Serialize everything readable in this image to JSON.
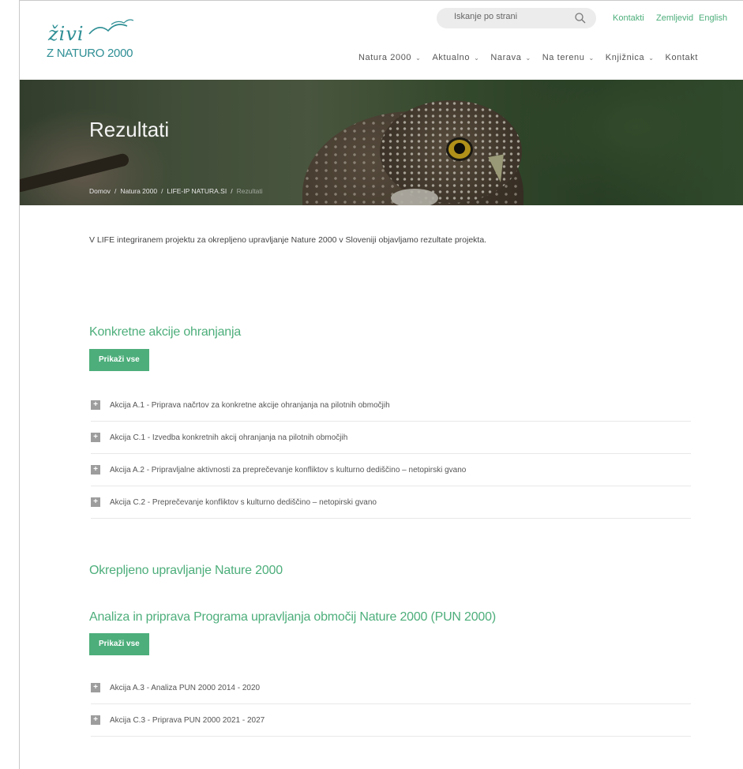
{
  "header": {
    "logo_script": "živi",
    "logo_sub": "Z NATURO 2000",
    "search_placeholder": "Iskanje po strani",
    "top_links": [
      "Kontakti",
      "Zemljevid",
      "English"
    ]
  },
  "nav": [
    "Natura 2000",
    "Aktualno",
    "Narava",
    "Na terenu",
    "Knjižnica",
    "Kontakt"
  ],
  "hero": {
    "title": "Rezultati",
    "breadcrumb": [
      "Domov",
      "Natura 2000",
      "LIFE-IP NATURA.SI",
      "Rezultati"
    ]
  },
  "intro": "V LIFE integriranem projektu za okrepljeno upravljanje Nature 2000 v Sloveniji objavljamo rezultate projekta.",
  "section1": {
    "heading": "Konkretne akcije ohranjanja",
    "button": "Prikaži vse",
    "items": [
      "Akcija A.1 - Priprava načrtov za konkretne akcije ohranjanja na pilotnih območjih",
      "Akcija C.1 - Izvedba konkretnih akcij ohranjanja na pilotnih območjih",
      "Akcija A.2 - Pripravljalne aktivnosti za preprečevanje konfliktov s kulturno dediščino – netopirski gvano",
      "Akcija C.2 - Preprečevanje konfliktov s kulturno dediščino – netopirski gvano"
    ]
  },
  "section2": {
    "heading": "Okrepljeno upravljanje Nature 2000",
    "subheading": "Analiza in priprava Programa upravljanja območij Nature 2000 (PUN 2000)",
    "button": "Prikaži vse",
    "items": [
      "Akcija A.3 - Analiza PUN 2000 2014 - 2020",
      "Akcija C.3 - Priprava PUN 2000 2021 - 2027"
    ]
  },
  "colors": {
    "accent": "#4dae7b",
    "logo": "#2f8f95",
    "plus": "#9d9d9d"
  }
}
